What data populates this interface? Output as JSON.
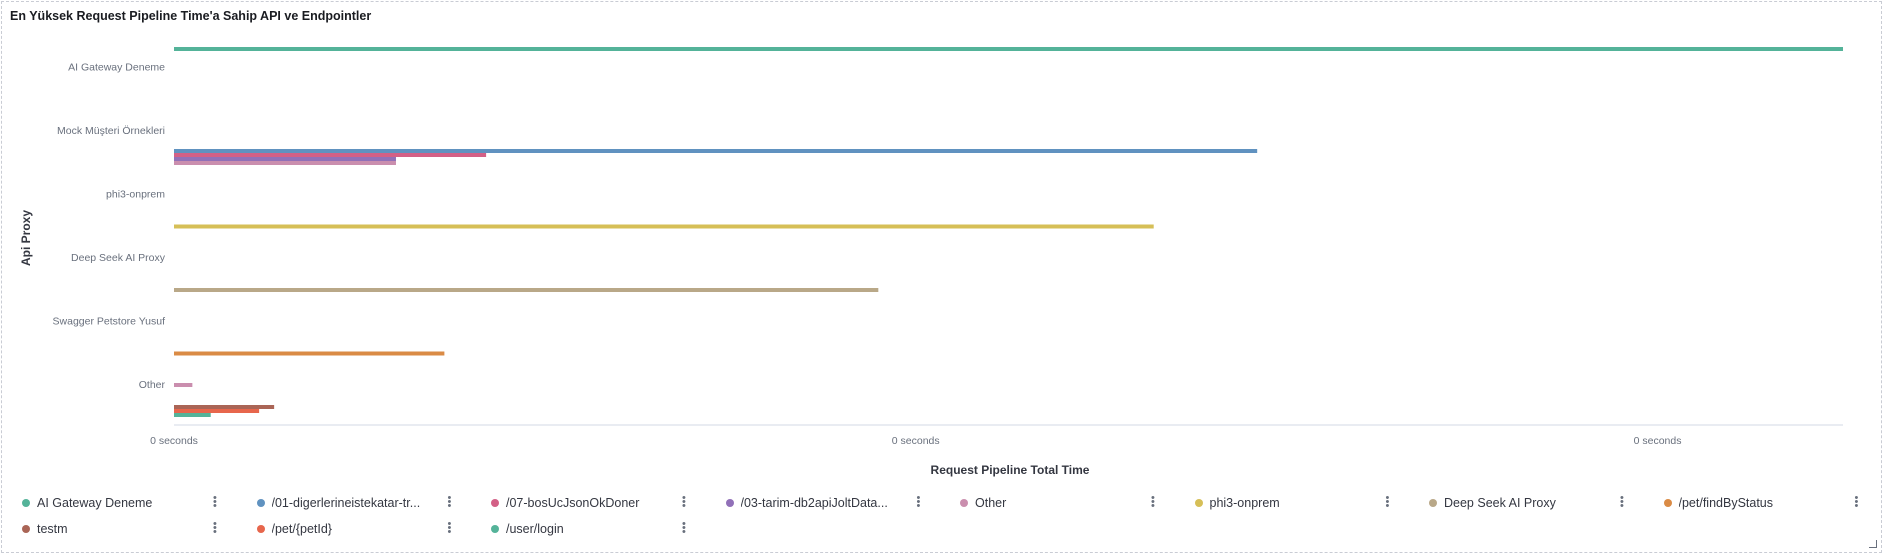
{
  "panel": {
    "title": "En Yüksek Request Pipeline Time'a Sahip API ve Endpointler"
  },
  "chart_data": {
    "type": "bar",
    "orientation": "horizontal",
    "categories": [
      "AI Gateway Deneme",
      "Mock Müşteri Örnekleri",
      "phi3-onprem",
      "Deep Seek AI Proxy",
      "Swagger Petstore Yusuf",
      "Other"
    ],
    "xlabel": "Request Pipeline Total Time",
    "ylabel": "Api Proxy",
    "x_tick_labels": [
      "0 seconds",
      "0 seconds",
      "0 seconds"
    ],
    "x_ticks": [
      0.0,
      0.4444,
      0.8889
    ],
    "xlim": [
      0,
      1
    ],
    "grid": false,
    "legend_position": "bottom",
    "series": [
      {
        "name": "AI Gateway Deneme",
        "color": "#54b399",
        "values": [
          1.0,
          0,
          0,
          0,
          0,
          0
        ]
      },
      {
        "name": "/01-digerlerineistekatar-tr...",
        "color": "#6092c0",
        "values": [
          0,
          0.649,
          0,
          0,
          0,
          0
        ]
      },
      {
        "name": "/07-bosUcJsonOkDoner",
        "color": "#d36086",
        "values": [
          0,
          0.187,
          0,
          0,
          0,
          0
        ]
      },
      {
        "name": "/03-tarim-db2apiJoltData...",
        "color": "#9170b8",
        "values": [
          0,
          0.133,
          0,
          0,
          0,
          0
        ]
      },
      {
        "name": "Other",
        "color": "#ca8eae",
        "values": [
          0,
          0.133,
          0,
          0,
          0,
          0.011
        ]
      },
      {
        "name": "phi3-onprem",
        "color": "#d6bf57",
        "values": [
          0,
          0,
          0.587,
          0,
          0,
          0
        ]
      },
      {
        "name": "Deep Seek AI Proxy",
        "color": "#b9a888",
        "values": [
          0,
          0,
          0,
          0.422,
          0,
          0
        ]
      },
      {
        "name": "/pet/findByStatus",
        "color": "#da8b45",
        "values": [
          0,
          0,
          0,
          0,
          0.162,
          0
        ]
      },
      {
        "name": "testm",
        "color": "#aa6556",
        "values": [
          0,
          0,
          0,
          0,
          0,
          0.06
        ]
      },
      {
        "name": "/pet/{petId}",
        "color": "#e7664c",
        "values": [
          0,
          0,
          0,
          0,
          0,
          0.051
        ]
      },
      {
        "name": "/user/login",
        "color": "#54b399",
        "values": [
          0,
          0,
          0,
          0,
          0,
          0.022
        ]
      }
    ]
  },
  "legend": {
    "items": [
      {
        "label": "AI Gateway Deneme",
        "color": "#54b399"
      },
      {
        "label": "/01-digerlerineistekatar-tr...",
        "color": "#6092c0"
      },
      {
        "label": "/07-bosUcJsonOkDoner",
        "color": "#d36086"
      },
      {
        "label": "/03-tarim-db2apiJoltData...",
        "color": "#9170b8"
      },
      {
        "label": "Other",
        "color": "#ca8eae"
      },
      {
        "label": "phi3-onprem",
        "color": "#d6bf57"
      },
      {
        "label": "Deep Seek AI Proxy",
        "color": "#b9a888"
      },
      {
        "label": "/pet/findByStatus",
        "color": "#da8b45"
      },
      {
        "label": "testm",
        "color": "#aa6556"
      },
      {
        "label": "/pet/{petId}",
        "color": "#e7664c"
      },
      {
        "label": "/user/login",
        "color": "#54b399"
      }
    ],
    "menu_icon": "vertical-dots-icon"
  },
  "icons": {
    "resize": "resize-handle-icon"
  }
}
